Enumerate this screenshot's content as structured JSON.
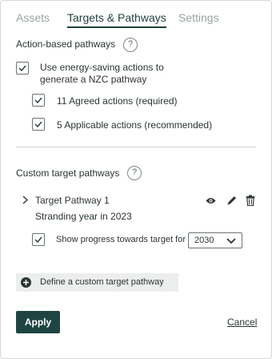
{
  "tabs": [
    {
      "label": "Assets",
      "active": false
    },
    {
      "label": "Targets & Pathways",
      "active": true
    },
    {
      "label": "Settings",
      "active": false
    }
  ],
  "action_section": {
    "title": "Action-based pathways",
    "help_icon": "question-icon",
    "use_actions": {
      "label_line1": "Use energy-saving actions to",
      "label_line2": "generate a NZC pathway",
      "checked": true
    },
    "agreed": {
      "label": "11 Agreed actions (required)",
      "checked": true
    },
    "applicable": {
      "label": "5 Applicable actions (recommended)",
      "checked": true
    }
  },
  "custom_section": {
    "title": "Custom target pathways",
    "help_icon": "question-icon",
    "pathway": {
      "name": "Target Pathway 1",
      "stranding": "Stranding year in 2023",
      "icons": [
        "eye-icon",
        "pencil-icon",
        "trash-icon"
      ],
      "progress": {
        "label": "Show progress towards target for",
        "checked": true,
        "year": "2030"
      }
    },
    "define_label": "Define a custom target pathway"
  },
  "footer": {
    "apply_label": "Apply",
    "cancel_label": "Cancel"
  },
  "colors": {
    "accent": "#1f4542",
    "text": "#2b3533",
    "muted": "#9aa3a1",
    "define_bg": "#eceeed"
  }
}
